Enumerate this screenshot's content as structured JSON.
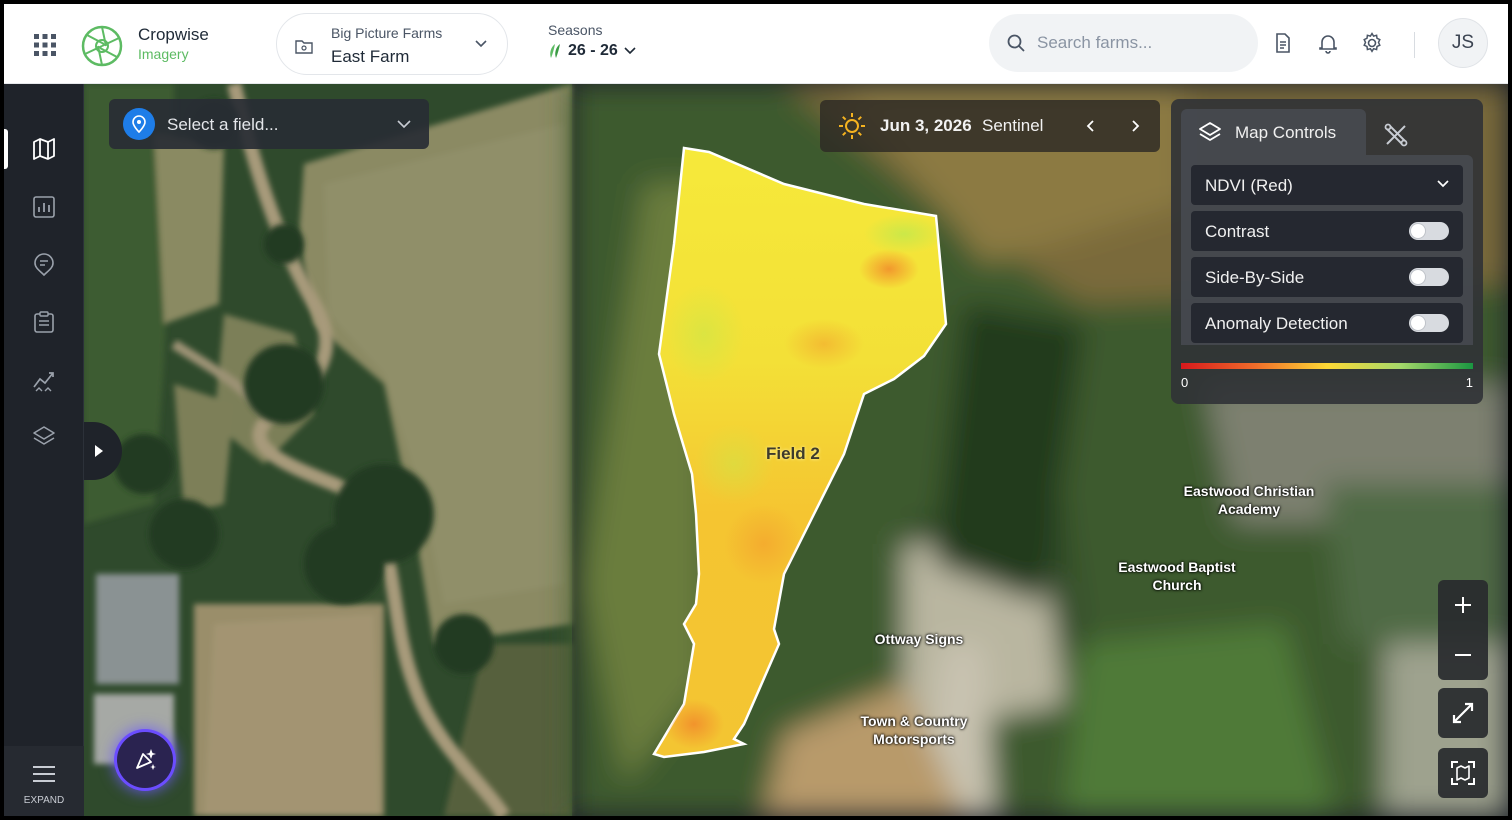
{
  "header": {
    "brand_name": "Cropwise",
    "brand_product": "Imagery",
    "organization": "Big Picture Farms",
    "farm": "East Farm",
    "seasons_label": "Seasons",
    "season_value": "26 - 26",
    "search_placeholder": "Search farms...",
    "user_initials": "JS"
  },
  "sidebar": {
    "items": [
      "map",
      "reports",
      "scouting",
      "tasks",
      "analytics",
      "layers"
    ],
    "expand_label": "EXPAND"
  },
  "map": {
    "field_select_placeholder": "Select a field...",
    "date": "Jun 3, 2026",
    "imagery_source": "Sentinel",
    "field_name": "Field 2",
    "labels": {
      "academy": "Eastwood Christian Academy",
      "church": "Eastwood Baptist Church",
      "signs": "Ottway Signs",
      "motorsports": "Town & Country Motorsports"
    }
  },
  "map_controls": {
    "title": "Map Controls",
    "layer": "NDVI (Red)",
    "options": [
      {
        "label": "Contrast",
        "enabled": false
      },
      {
        "label": "Side-By-Side",
        "enabled": false
      },
      {
        "label": "Anomaly Detection",
        "enabled": false
      }
    ],
    "scale_min": "0",
    "scale_max": "1"
  },
  "colors": {
    "accent_green": "#5dbb63",
    "pin_blue": "#1e7de8",
    "ai_purple": "#6b4dff"
  }
}
